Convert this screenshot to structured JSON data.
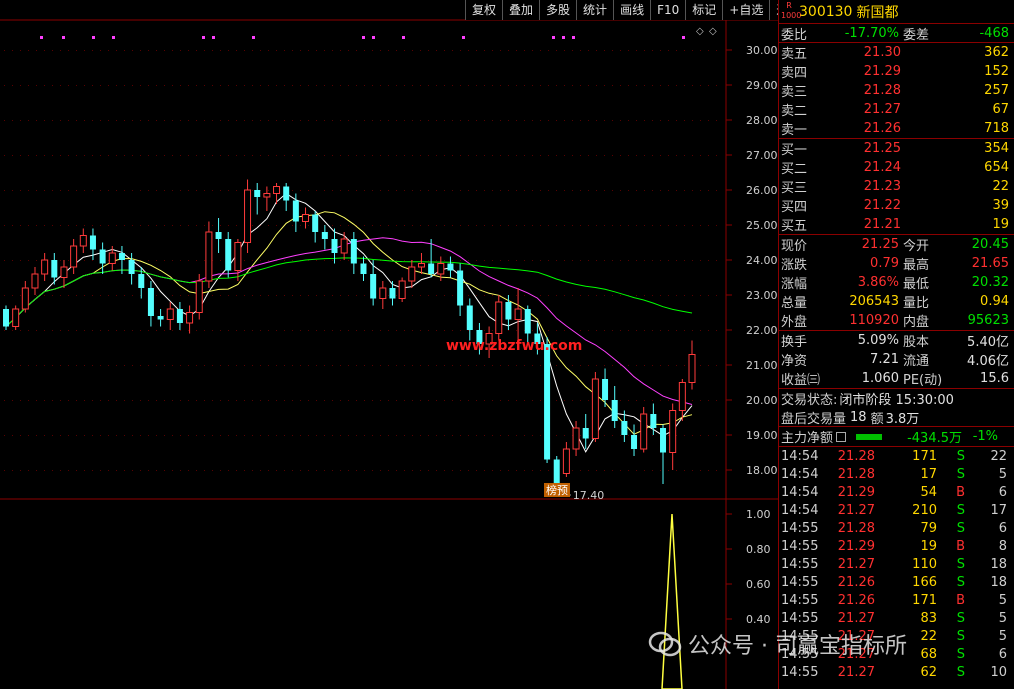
{
  "toolbar": [
    "复权",
    "叠加",
    "多股",
    "统计",
    "画线",
    "F10",
    "标记",
    "+自选",
    "返回"
  ],
  "stock": {
    "badge_top": "R",
    "badge_bottom": "1000",
    "code": "300130",
    "name": "新国都"
  },
  "weibi": {
    "label1": "委比",
    "value1": "-17.70%",
    "label2": "委差",
    "value2": "-468"
  },
  "sell": [
    {
      "label": "卖五",
      "price": "21.30",
      "volume": "362"
    },
    {
      "label": "卖四",
      "price": "21.29",
      "volume": "152"
    },
    {
      "label": "卖三",
      "price": "21.28",
      "volume": "257"
    },
    {
      "label": "卖二",
      "price": "21.27",
      "volume": "67"
    },
    {
      "label": "卖一",
      "price": "21.26",
      "volume": "718"
    }
  ],
  "buy": [
    {
      "label": "买一",
      "price": "21.25",
      "volume": "354"
    },
    {
      "label": "买二",
      "price": "21.24",
      "volume": "654"
    },
    {
      "label": "买三",
      "price": "21.23",
      "volume": "22"
    },
    {
      "label": "买四",
      "price": "21.22",
      "volume": "39"
    },
    {
      "label": "买五",
      "price": "21.21",
      "volume": "19"
    }
  ],
  "quote": [
    {
      "l1": "现价",
      "v1": "21.25",
      "c1": "red",
      "l2": "今开",
      "v2": "20.45",
      "c2": "green"
    },
    {
      "l1": "涨跌",
      "v1": "0.79",
      "c1": "red",
      "l2": "最高",
      "v2": "21.65",
      "c2": "red"
    },
    {
      "l1": "涨幅",
      "v1": "3.86%",
      "c1": "red",
      "l2": "最低",
      "v2": "20.32",
      "c2": "green"
    },
    {
      "l1": "总量",
      "v1": "206543",
      "c1": "yellow",
      "l2": "量比",
      "v2": "0.94",
      "c2": "yellow"
    },
    {
      "l1": "外盘",
      "v1": "110920",
      "c1": "red",
      "l2": "内盘",
      "v2": "95623",
      "c2": "green"
    }
  ],
  "quote2": [
    {
      "l1": "换手",
      "v1": "5.09%",
      "l2": "股本",
      "v2": "5.40亿"
    },
    {
      "l1": "净资",
      "v1": "7.21",
      "l2": "流通",
      "v2": "4.06亿"
    },
    {
      "l1": "收益㈢",
      "v1": "1.060",
      "l2": "PE(动)",
      "v2": "15.6"
    }
  ],
  "trade_state": {
    "label": "交易状态:",
    "value": "闭市阶段 15:30:00"
  },
  "after_hours": {
    "label": "盘后交易量",
    "vol": "18",
    "amt_label": "额",
    "amt": "3.8万"
  },
  "main_flow": {
    "label": "主力净额",
    "value": "-434.5万",
    "pct": "-1%"
  },
  "ticks": [
    {
      "time": "14:54",
      "price": "21.28",
      "vol": "171",
      "side": "S",
      "num": "22"
    },
    {
      "time": "14:54",
      "price": "21.28",
      "vol": "17",
      "side": "S",
      "num": "5"
    },
    {
      "time": "14:54",
      "price": "21.29",
      "vol": "54",
      "side": "B",
      "num": "6"
    },
    {
      "time": "14:54",
      "price": "21.27",
      "vol": "210",
      "side": "S",
      "num": "17"
    },
    {
      "time": "14:55",
      "price": "21.28",
      "vol": "79",
      "side": "S",
      "num": "6"
    },
    {
      "time": "14:55",
      "price": "21.29",
      "vol": "19",
      "side": "B",
      "num": "8"
    },
    {
      "time": "14:55",
      "price": "21.27",
      "vol": "110",
      "side": "S",
      "num": "18"
    },
    {
      "time": "14:55",
      "price": "21.26",
      "vol": "166",
      "side": "S",
      "num": "18"
    },
    {
      "time": "14:55",
      "price": "21.26",
      "vol": "171",
      "side": "B",
      "num": "5"
    },
    {
      "time": "14:55",
      "price": "21.27",
      "vol": "83",
      "side": "S",
      "num": "5"
    },
    {
      "time": "14:55",
      "price": "21.27",
      "vol": "22",
      "side": "S",
      "num": "5"
    },
    {
      "time": "14:55",
      "price": "21.27",
      "vol": "68",
      "side": "S",
      "num": "6"
    },
    {
      "time": "14:55",
      "price": "21.27",
      "vol": "62",
      "side": "S",
      "num": "10"
    }
  ],
  "chart_data": {
    "type": "candlestick",
    "ylim": [
      17.2,
      30.8
    ],
    "y_ticks": [
      "30.00",
      "29.00",
      "28.00",
      "27.00",
      "26.00",
      "25.00",
      "24.00",
      "23.00",
      "22.00",
      "21.00",
      "20.00",
      "19.00",
      "18.00"
    ],
    "indicator_ticks": [
      "1.00",
      "0.80",
      "0.60",
      "0.40"
    ],
    "indicator_ylim": [
      0,
      1.08
    ],
    "low_annotation": "17.40",
    "tag": "榜预",
    "site_text": "www.zbzfwu.com",
    "candles": [
      [
        22.6,
        22.1,
        22.7,
        22.0
      ],
      [
        22.1,
        22.6,
        22.7,
        22.0
      ],
      [
        22.6,
        23.2,
        23.4,
        22.5
      ],
      [
        23.2,
        23.6,
        23.8,
        23.0
      ],
      [
        23.6,
        24.0,
        24.2,
        23.4
      ],
      [
        24.0,
        23.5,
        24.2,
        23.3
      ],
      [
        23.5,
        23.8,
        24.0,
        23.2
      ],
      [
        23.8,
        24.4,
        24.6,
        23.6
      ],
      [
        24.4,
        24.7,
        24.9,
        24.2
      ],
      [
        24.7,
        24.3,
        24.9,
        24.0
      ],
      [
        24.3,
        23.9,
        24.5,
        23.6
      ],
      [
        23.9,
        24.2,
        24.4,
        23.7
      ],
      [
        24.2,
        24.0,
        24.4,
        23.6
      ],
      [
        24.0,
        23.6,
        24.2,
        23.3
      ],
      [
        23.6,
        23.2,
        23.8,
        22.9
      ],
      [
        23.2,
        22.4,
        23.4,
        22.1
      ],
      [
        22.4,
        22.3,
        22.6,
        22.1
      ],
      [
        22.3,
        22.6,
        22.8,
        22.0
      ],
      [
        22.6,
        22.2,
        22.8,
        22.0
      ],
      [
        22.2,
        22.5,
        22.7,
        21.9
      ],
      [
        22.5,
        23.4,
        23.6,
        22.3
      ],
      [
        23.4,
        24.8,
        25.1,
        23.2
      ],
      [
        24.8,
        24.6,
        25.2,
        24.2
      ],
      [
        24.6,
        23.7,
        24.8,
        23.5
      ],
      [
        23.7,
        24.5,
        24.6,
        23.4
      ],
      [
        24.5,
        26.0,
        26.3,
        24.2
      ],
      [
        26.0,
        25.8,
        26.2,
        25.3
      ],
      [
        25.8,
        25.9,
        26.1,
        25.4
      ],
      [
        25.9,
        26.1,
        26.2,
        25.6
      ],
      [
        26.1,
        25.7,
        26.2,
        25.4
      ],
      [
        25.7,
        25.1,
        25.9,
        24.8
      ],
      [
        25.1,
        25.3,
        25.5,
        24.9
      ],
      [
        25.3,
        24.8,
        25.4,
        24.5
      ],
      [
        24.8,
        24.6,
        25.0,
        24.3
      ],
      [
        24.6,
        24.2,
        24.9,
        23.9
      ],
      [
        24.2,
        24.6,
        24.8,
        24.0
      ],
      [
        24.6,
        23.9,
        24.8,
        23.6
      ],
      [
        23.9,
        23.6,
        24.1,
        23.4
      ],
      [
        23.6,
        22.9,
        24.0,
        22.7
      ],
      [
        22.9,
        23.2,
        23.4,
        22.6
      ],
      [
        23.2,
        22.9,
        23.4,
        22.7
      ],
      [
        22.9,
        23.4,
        23.5,
        22.8
      ],
      [
        23.4,
        23.8,
        24.0,
        23.2
      ],
      [
        23.8,
        23.9,
        24.2,
        23.6
      ],
      [
        23.9,
        23.6,
        24.6,
        23.5
      ],
      [
        23.6,
        23.9,
        24.1,
        23.4
      ],
      [
        23.9,
        23.7,
        24.1,
        23.5
      ],
      [
        23.7,
        22.7,
        23.9,
        22.4
      ],
      [
        22.7,
        22.0,
        22.9,
        21.7
      ],
      [
        22.0,
        21.6,
        22.2,
        21.3
      ],
      [
        21.6,
        21.9,
        22.1,
        21.2
      ],
      [
        21.9,
        22.8,
        23.0,
        21.7
      ],
      [
        22.8,
        22.3,
        23.0,
        22.0
      ],
      [
        22.3,
        22.6,
        23.2,
        21.7
      ],
      [
        22.6,
        21.9,
        22.7,
        21.6
      ],
      [
        21.9,
        21.6,
        22.2,
        21.3
      ],
      [
        21.6,
        18.3,
        21.8,
        18.2
      ],
      [
        18.3,
        17.6,
        18.4,
        17.4
      ],
      [
        17.9,
        18.6,
        18.8,
        17.8
      ],
      [
        18.6,
        19.2,
        19.4,
        18.4
      ],
      [
        19.2,
        18.9,
        19.6,
        18.6
      ],
      [
        18.9,
        20.6,
        20.8,
        18.8
      ],
      [
        20.6,
        20.0,
        20.9,
        19.8
      ],
      [
        20.0,
        19.4,
        20.4,
        19.2
      ],
      [
        19.4,
        19.0,
        19.7,
        18.8
      ],
      [
        19.0,
        18.6,
        19.3,
        18.4
      ],
      [
        18.6,
        19.6,
        19.8,
        18.5
      ],
      [
        19.6,
        19.2,
        19.9,
        19.0
      ],
      [
        19.2,
        18.5,
        19.3,
        17.6
      ],
      [
        18.5,
        19.7,
        19.9,
        18.0
      ],
      [
        19.7,
        20.5,
        20.6,
        19.4
      ],
      [
        20.5,
        21.3,
        21.7,
        20.3
      ]
    ]
  }
}
